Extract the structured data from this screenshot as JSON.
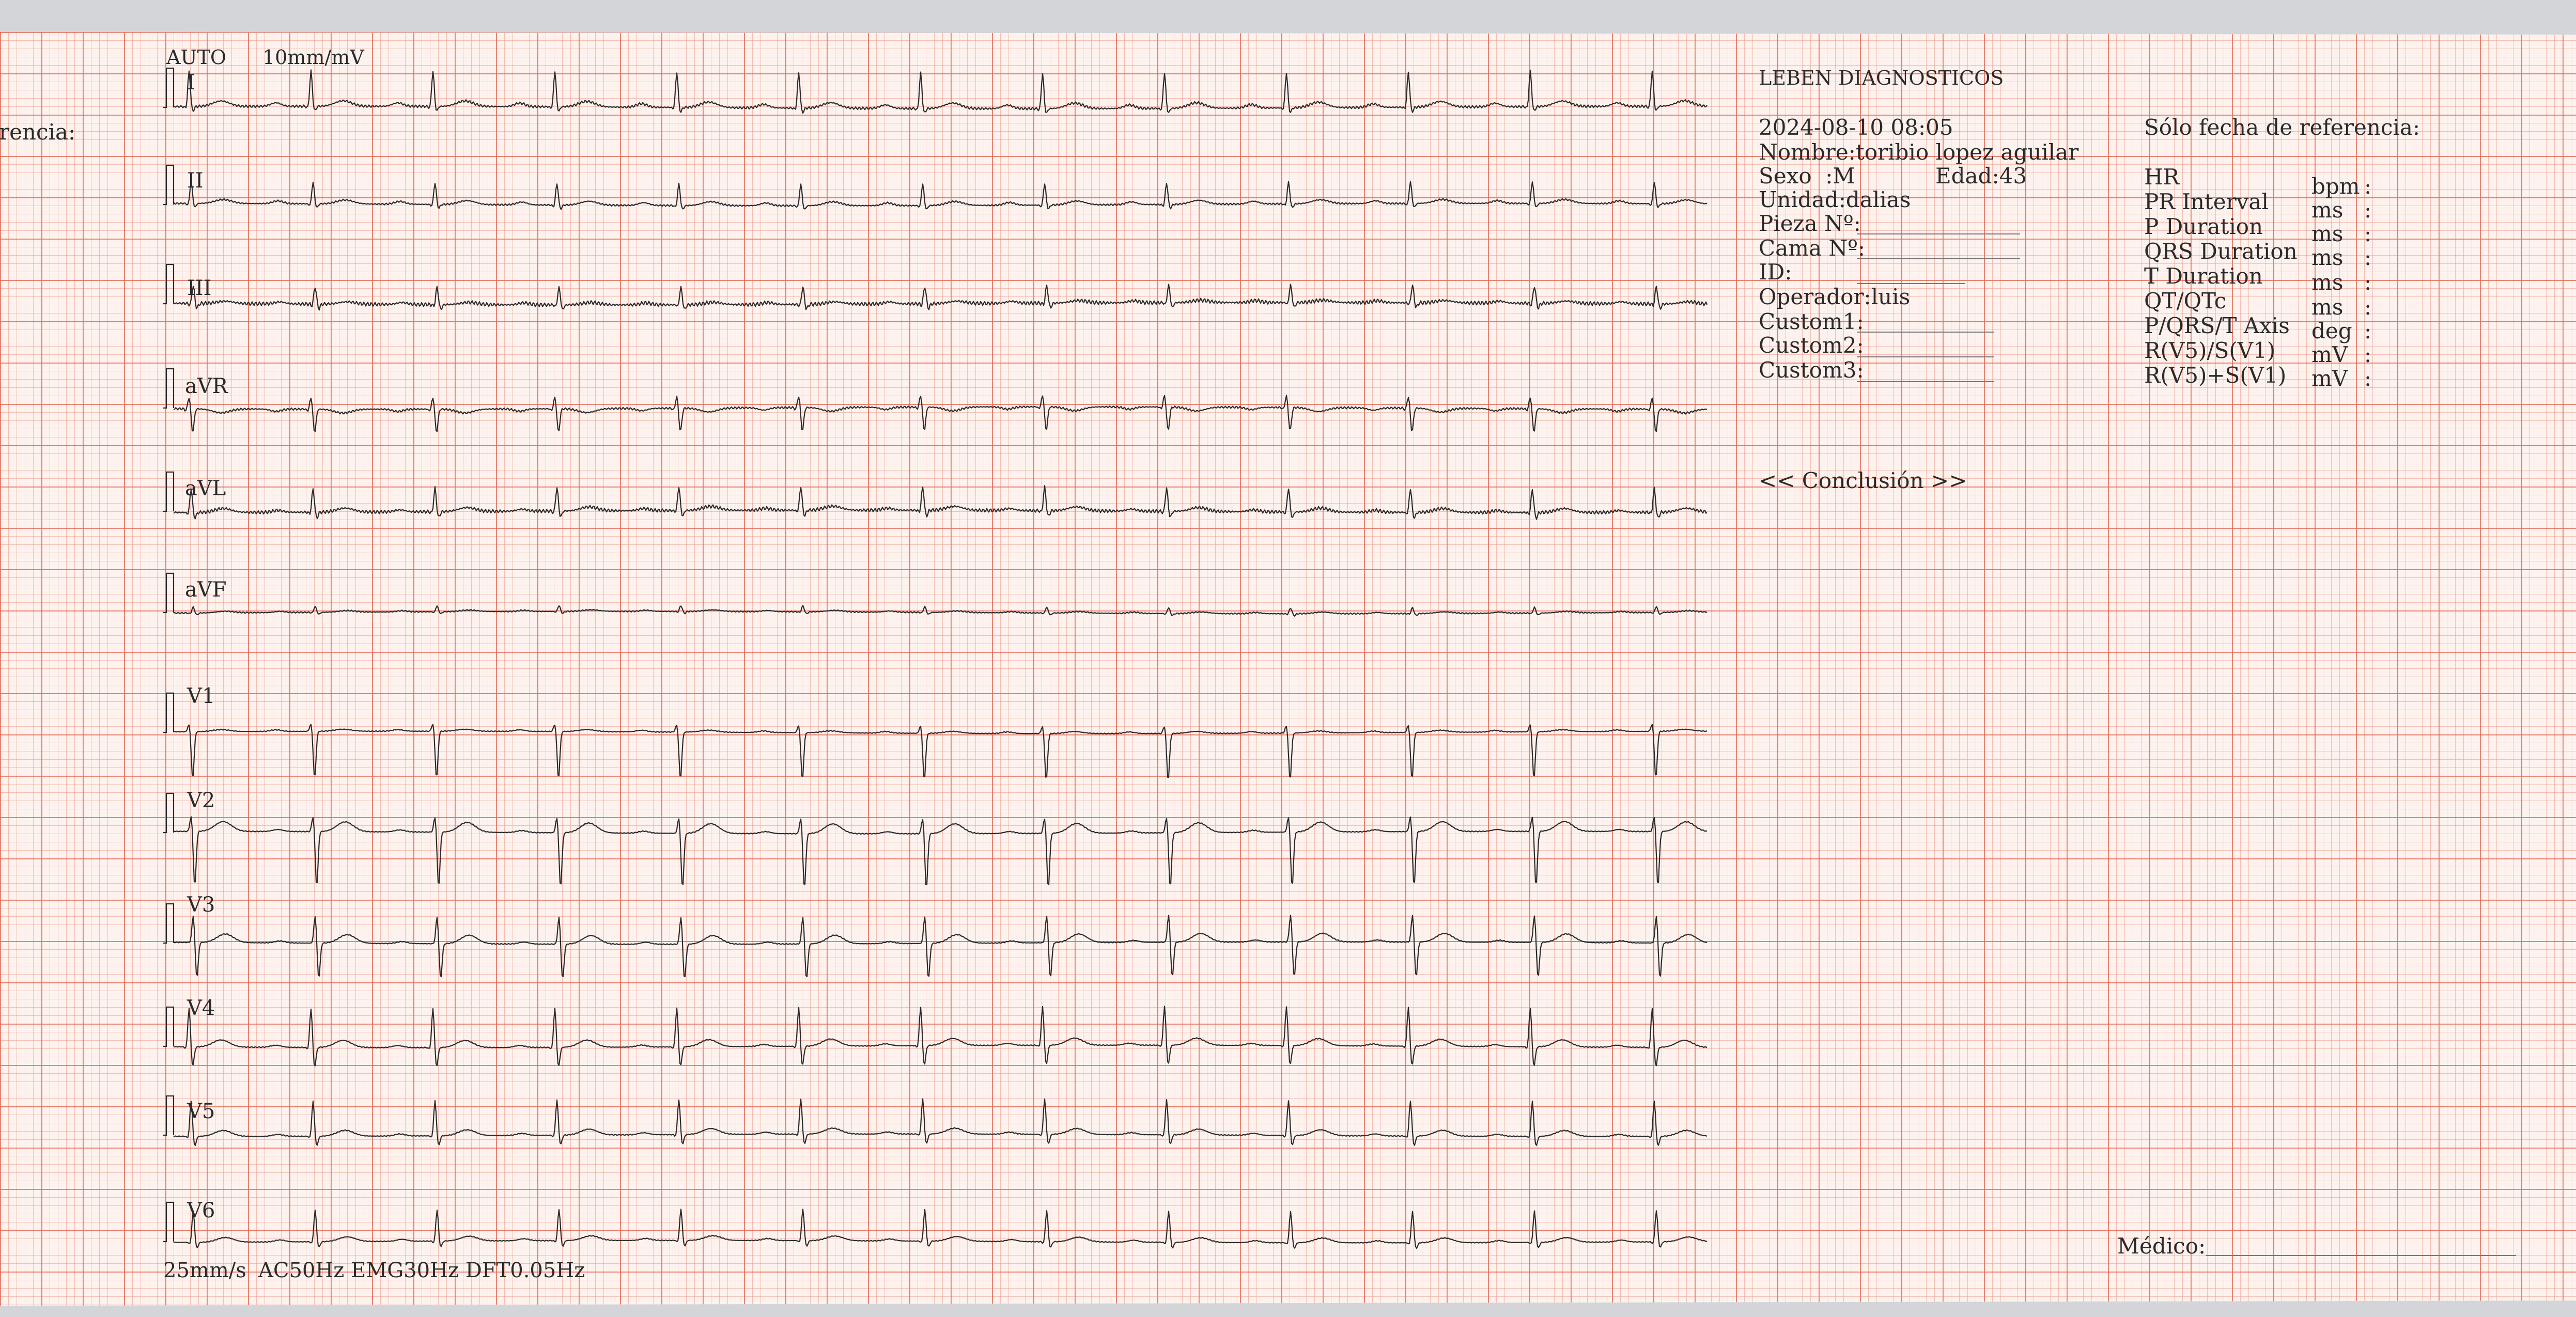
{
  "left_edge_text": "rencia:",
  "header": {
    "auto": "AUTO",
    "gain": "10mm/mV"
  },
  "leads": [
    {
      "label": "I",
      "qrs": 0.9,
      "q": 0.05,
      "s": 0.12,
      "p": 0.09,
      "t": 0.14,
      "noise": 0.06
    },
    {
      "label": "II",
      "qrs": 0.55,
      "q": 0.05,
      "s": 0.1,
      "p": 0.07,
      "t": 0.1,
      "noise": 0.04
    },
    {
      "label": "III",
      "qrs": 0.45,
      "q": 0.05,
      "s": 0.12,
      "p": 0.05,
      "t": 0.06,
      "noise": 0.09
    },
    {
      "label": "aVR",
      "qrs": 0.3,
      "q": 0.05,
      "s": 0.6,
      "p": -0.06,
      "t": -0.1,
      "noise": 0.05
    },
    {
      "label": "aVL",
      "qrs": 0.6,
      "q": 0.05,
      "s": 0.15,
      "p": 0.05,
      "t": 0.1,
      "noise": 0.08
    },
    {
      "label": "aVF",
      "qrs": 0.15,
      "q": 0.02,
      "s": 0.05,
      "p": 0.03,
      "t": 0.04,
      "noise": 0.03
    },
    {
      "label": "V1",
      "qrs": 0.2,
      "q": 0.0,
      "s": 1.2,
      "p": 0.04,
      "t": 0.05,
      "noise": 0.02
    },
    {
      "label": "V2",
      "qrs": 0.4,
      "q": 0.0,
      "s": 1.4,
      "p": 0.05,
      "t": 0.25,
      "noise": 0.02
    },
    {
      "label": "V3",
      "qrs": 0.7,
      "q": 0.0,
      "s": 0.9,
      "p": 0.05,
      "t": 0.22,
      "noise": 0.02
    },
    {
      "label": "V4",
      "qrs": 1.0,
      "q": 0.05,
      "s": 0.5,
      "p": 0.05,
      "t": 0.18,
      "noise": 0.02
    },
    {
      "label": "V5",
      "qrs": 0.9,
      "q": 0.05,
      "s": 0.25,
      "p": 0.05,
      "t": 0.15,
      "noise": 0.02
    },
    {
      "label": "V6",
      "qrs": 0.8,
      "q": 0.05,
      "s": 0.15,
      "p": 0.05,
      "t": 0.12,
      "noise": 0.02
    }
  ],
  "footer": {
    "speed": "25mm/s",
    "filters": "AC50Hz EMG30Hz DFT0.05Hz",
    "medico": "Médico:"
  },
  "patient": {
    "clinic": "LEBEN DIAGNOSTICOS",
    "datetime": "2024-08-10 08:05",
    "name": "Nombre:toribio lopez aguilar",
    "sex": "Sexo  :M",
    "age": "Edad:43",
    "unit": "Unidad:dalias",
    "room": "Pieza Nº:",
    "bed": "Cama Nº:",
    "id": "ID:",
    "operator": "Operador:luis",
    "custom1": "Custom1:",
    "custom2": "Custom2:",
    "custom3": "Custom3:",
    "conclusion": "<< Conclusión >>"
  },
  "reference": "Sólo fecha de referencia:",
  "measurements": [
    {
      "name": "HR",
      "unit": "bpm",
      "value": ":"
    },
    {
      "name": "PR Interval",
      "unit": "ms",
      "value": ":"
    },
    {
      "name": "P Duration",
      "unit": "ms",
      "value": ":"
    },
    {
      "name": "QRS Duration",
      "unit": "ms",
      "value": ":"
    },
    {
      "name": "T Duration",
      "unit": "ms",
      "value": ":"
    },
    {
      "name": "QT/QTc",
      "unit": "ms",
      "value": ":"
    },
    {
      "name": "P/QRS/T Axis",
      "unit": "deg",
      "value": ":"
    },
    {
      "name": "R(V5)/S(V1)",
      "unit": "mV",
      "value": ":"
    },
    {
      "name": "R(V5)+S(V1)",
      "unit": "mV",
      "value": ":"
    }
  ],
  "colors": {
    "paper": "#fdf2ee",
    "grid_major": "#e46652",
    "trace": "#2b2b2b"
  }
}
